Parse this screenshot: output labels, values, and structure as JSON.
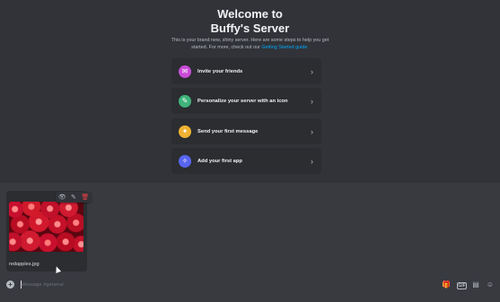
{
  "welcome": {
    "title_line1": "Welcome to",
    "title_line2": "Buffy's Server",
    "subtitle_text": "This is your brand new, shiny server. Here are some steps to help you get started. For more, check out our ",
    "subtitle_link": "Getting Started guide.",
    "steps": [
      {
        "label": "Invite your friends",
        "icon": "invite-friends-icon",
        "color": "#c94bd9"
      },
      {
        "label": "Personalize your server with an icon",
        "icon": "paintbrush-icon",
        "color": "#3fb47c"
      },
      {
        "label": "Send your first message",
        "icon": "message-bubble-icon",
        "color": "#f0b232"
      },
      {
        "label": "Add your first app",
        "icon": "app-rocket-icon",
        "color": "#5865f2"
      }
    ]
  },
  "attachment": {
    "filename": "redapples.jpg",
    "actions": [
      "view-icon",
      "edit-icon",
      "delete-icon"
    ]
  },
  "composer": {
    "placeholder": "Message #general",
    "right_icons": [
      "gift-icon",
      "gif-icon",
      "sticker-icon",
      "emoji-icon"
    ],
    "gif_label": "GIF"
  },
  "colors": {
    "background": "#313338",
    "card": "#2b2d31",
    "composer": "#383a40",
    "link": "#00a8fc",
    "delete": "#f23f42"
  }
}
